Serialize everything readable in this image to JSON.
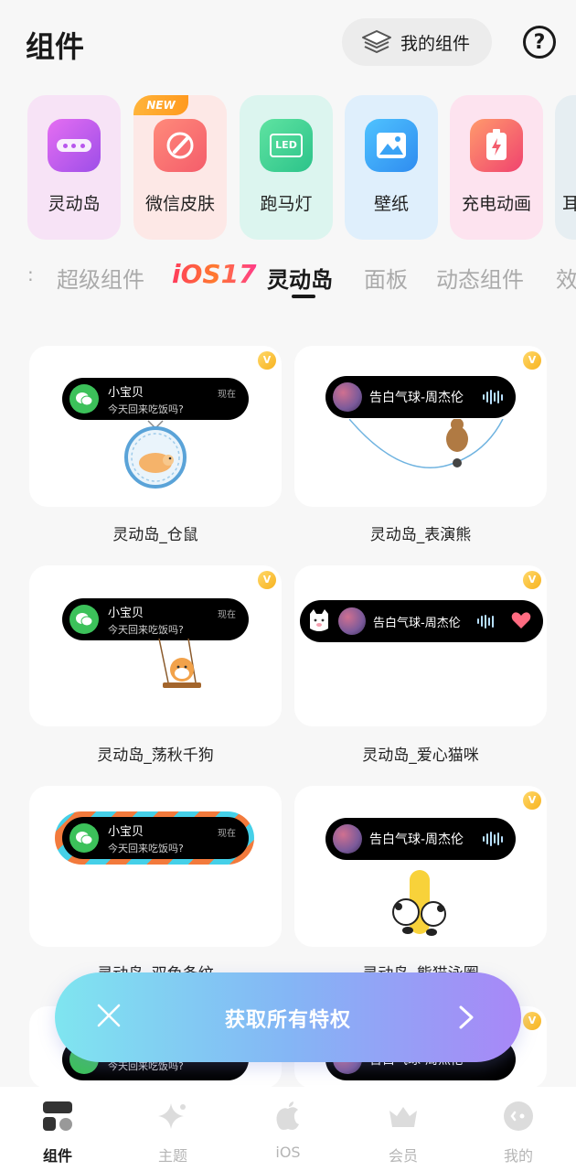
{
  "header": {
    "title": "组件",
    "my_widgets_label": "我的组件",
    "help_symbol": "?"
  },
  "categories": [
    {
      "label": "灵动岛",
      "bg": "#f7e3f6",
      "icon": "dynamic-island-icon"
    },
    {
      "label": "微信皮肤",
      "bg": "#fde8e6",
      "icon": "paint-brush-icon",
      "badge": "NEW"
    },
    {
      "label": "跑马灯",
      "bg": "#dcf5ef",
      "icon": "led-icon",
      "icon_text": "LED"
    },
    {
      "label": "壁纸",
      "bg": "#dfeffc",
      "icon": "wallpaper-icon"
    },
    {
      "label": "充电动画",
      "bg": "#fde3ef",
      "icon": "battery-charge-icon"
    },
    {
      "label": "耳",
      "bg": "#e6eef2",
      "icon": "earphone-icon"
    }
  ],
  "tabs": {
    "prefix": ":",
    "items": [
      "超级组件",
      "iOS17",
      "灵动岛",
      "面板",
      "动态组件",
      "效"
    ],
    "active": "灵动岛"
  },
  "cards": [
    {
      "title": "灵动岛_仓鼠",
      "vip": "V",
      "kind": "chat",
      "name": "小宝贝",
      "msg": "今天回来吃饭吗?",
      "time": "现在"
    },
    {
      "title": "灵动岛_表演熊",
      "vip": "V",
      "kind": "song",
      "song": "告白气球-周杰伦"
    },
    {
      "title": "灵动岛_荡秋千狗",
      "vip": "V",
      "kind": "chat",
      "name": "小宝贝",
      "msg": "今天回来吃饭吗?",
      "time": "现在"
    },
    {
      "title": "灵动岛_爱心猫咪",
      "vip": "V",
      "kind": "song",
      "song": "告白气球-周杰伦"
    },
    {
      "title": "灵动岛_双色条纹",
      "kind": "chat",
      "name": "小宝贝",
      "msg": "今天回来吃饭吗?",
      "time": "现在"
    },
    {
      "title": "灵动岛_熊猫泳圈",
      "vip": "V",
      "kind": "song",
      "song": "告白气球-周杰伦"
    },
    {
      "kind": "chat",
      "msg": "今天回来吃饭吗?"
    },
    {
      "vip": "V",
      "kind": "song",
      "song": "告白气球-周杰伦"
    }
  ],
  "promo": {
    "text": "获取所有特权"
  },
  "bottom_nav": [
    {
      "label": "组件",
      "icon": "widgets-icon",
      "active": true
    },
    {
      "label": "主题",
      "icon": "sparkle-icon"
    },
    {
      "label": "iOS",
      "icon": "apple-icon"
    },
    {
      "label": "会员",
      "icon": "crown-icon"
    },
    {
      "label": "我的",
      "icon": "profile-icon"
    }
  ],
  "colors": {
    "accent": "#1a1a1a",
    "promo_start": "#7fe5f0",
    "promo_end": "#a887f7",
    "wechat_green": "#3cc15a",
    "vip_gold": "#f7b21e"
  }
}
